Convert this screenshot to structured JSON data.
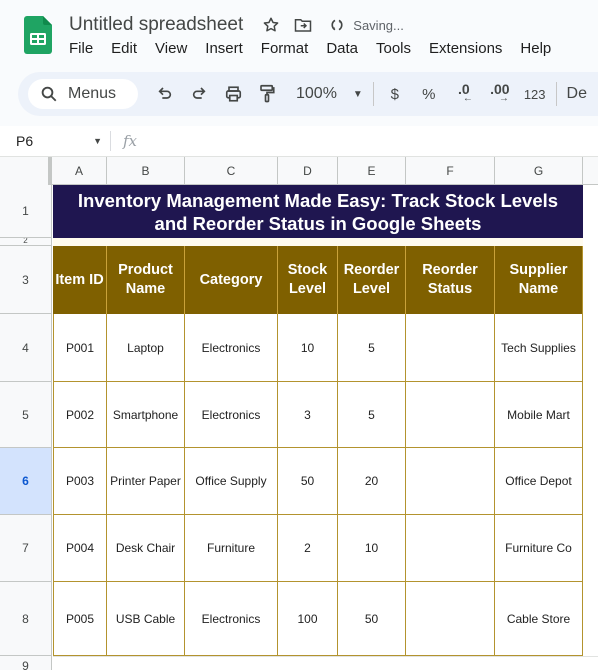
{
  "app": {
    "title": "Untitled spreadsheet",
    "status": "Saving...",
    "menus": [
      "File",
      "Edit",
      "View",
      "Insert",
      "Format",
      "Data",
      "Tools",
      "Extensions",
      "Help"
    ]
  },
  "toolbar": {
    "search_label": "Menus",
    "zoom": "100%",
    "currency": "$",
    "percent": "%",
    "dec_decrease": ".0",
    "dec_increase": ".00",
    "number_format": "123",
    "font": "De"
  },
  "formula_bar": {
    "name_box": "P6",
    "fx": "fx",
    "value": ""
  },
  "grid": {
    "columns": [
      "A",
      "B",
      "C",
      "D",
      "E",
      "F",
      "G"
    ],
    "rows": [
      "1",
      "2",
      "3",
      "4",
      "5",
      "6",
      "7",
      "8",
      "9"
    ],
    "selected_row": "6",
    "title": "Inventory Management Made Easy: Track Stock Levels and Reorder Status in Google Sheets",
    "headers": [
      "Item ID",
      "Product Name",
      "Category",
      "Stock Level",
      "Reorder Level",
      "Reorder Status",
      "Supplier Name"
    ],
    "data": [
      [
        "P001",
        "Laptop",
        "Electronics",
        "10",
        "5",
        "",
        "Tech Supplies"
      ],
      [
        "P002",
        "Smartphone",
        "Electronics",
        "3",
        "5",
        "",
        "Mobile Mart"
      ],
      [
        "P003",
        "Printer Paper",
        "Office Supply",
        "50",
        "20",
        "",
        "Office Depot"
      ],
      [
        "P004",
        "Desk Chair",
        "Furniture",
        "2",
        "10",
        "",
        "Furniture Co"
      ],
      [
        "P005",
        "USB Cable",
        "Electronics",
        "100",
        "50",
        "",
        "Cable Store"
      ]
    ]
  },
  "colors": {
    "title_bg": "#1f1650",
    "header_bg": "#7f6000",
    "border": "#b3932e",
    "selected_row": "#d3e3fd"
  }
}
